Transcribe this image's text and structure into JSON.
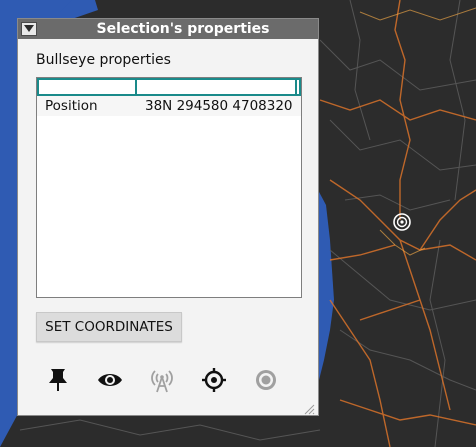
{
  "panel": {
    "title": "Selection's properties",
    "section_label": "Bullseye properties",
    "table": {
      "headers": [
        "",
        ""
      ],
      "rows": [
        {
          "key": "Position",
          "value": "38N 294580 4708320"
        }
      ]
    },
    "set_button_label": "SET COORDINATES",
    "toolbar": {
      "icons": [
        "pin-icon",
        "eye-icon",
        "antenna-icon",
        "crosshair-icon",
        "bullseye-icon"
      ]
    }
  },
  "colors": {
    "map_background": "#2c2c2c",
    "water": "#2f5bb3",
    "roads": "#d8722a",
    "titlebar": "#6b6b6b",
    "header_accent": "#1a8a8a",
    "disabled_icon": "#a0a0a0"
  }
}
